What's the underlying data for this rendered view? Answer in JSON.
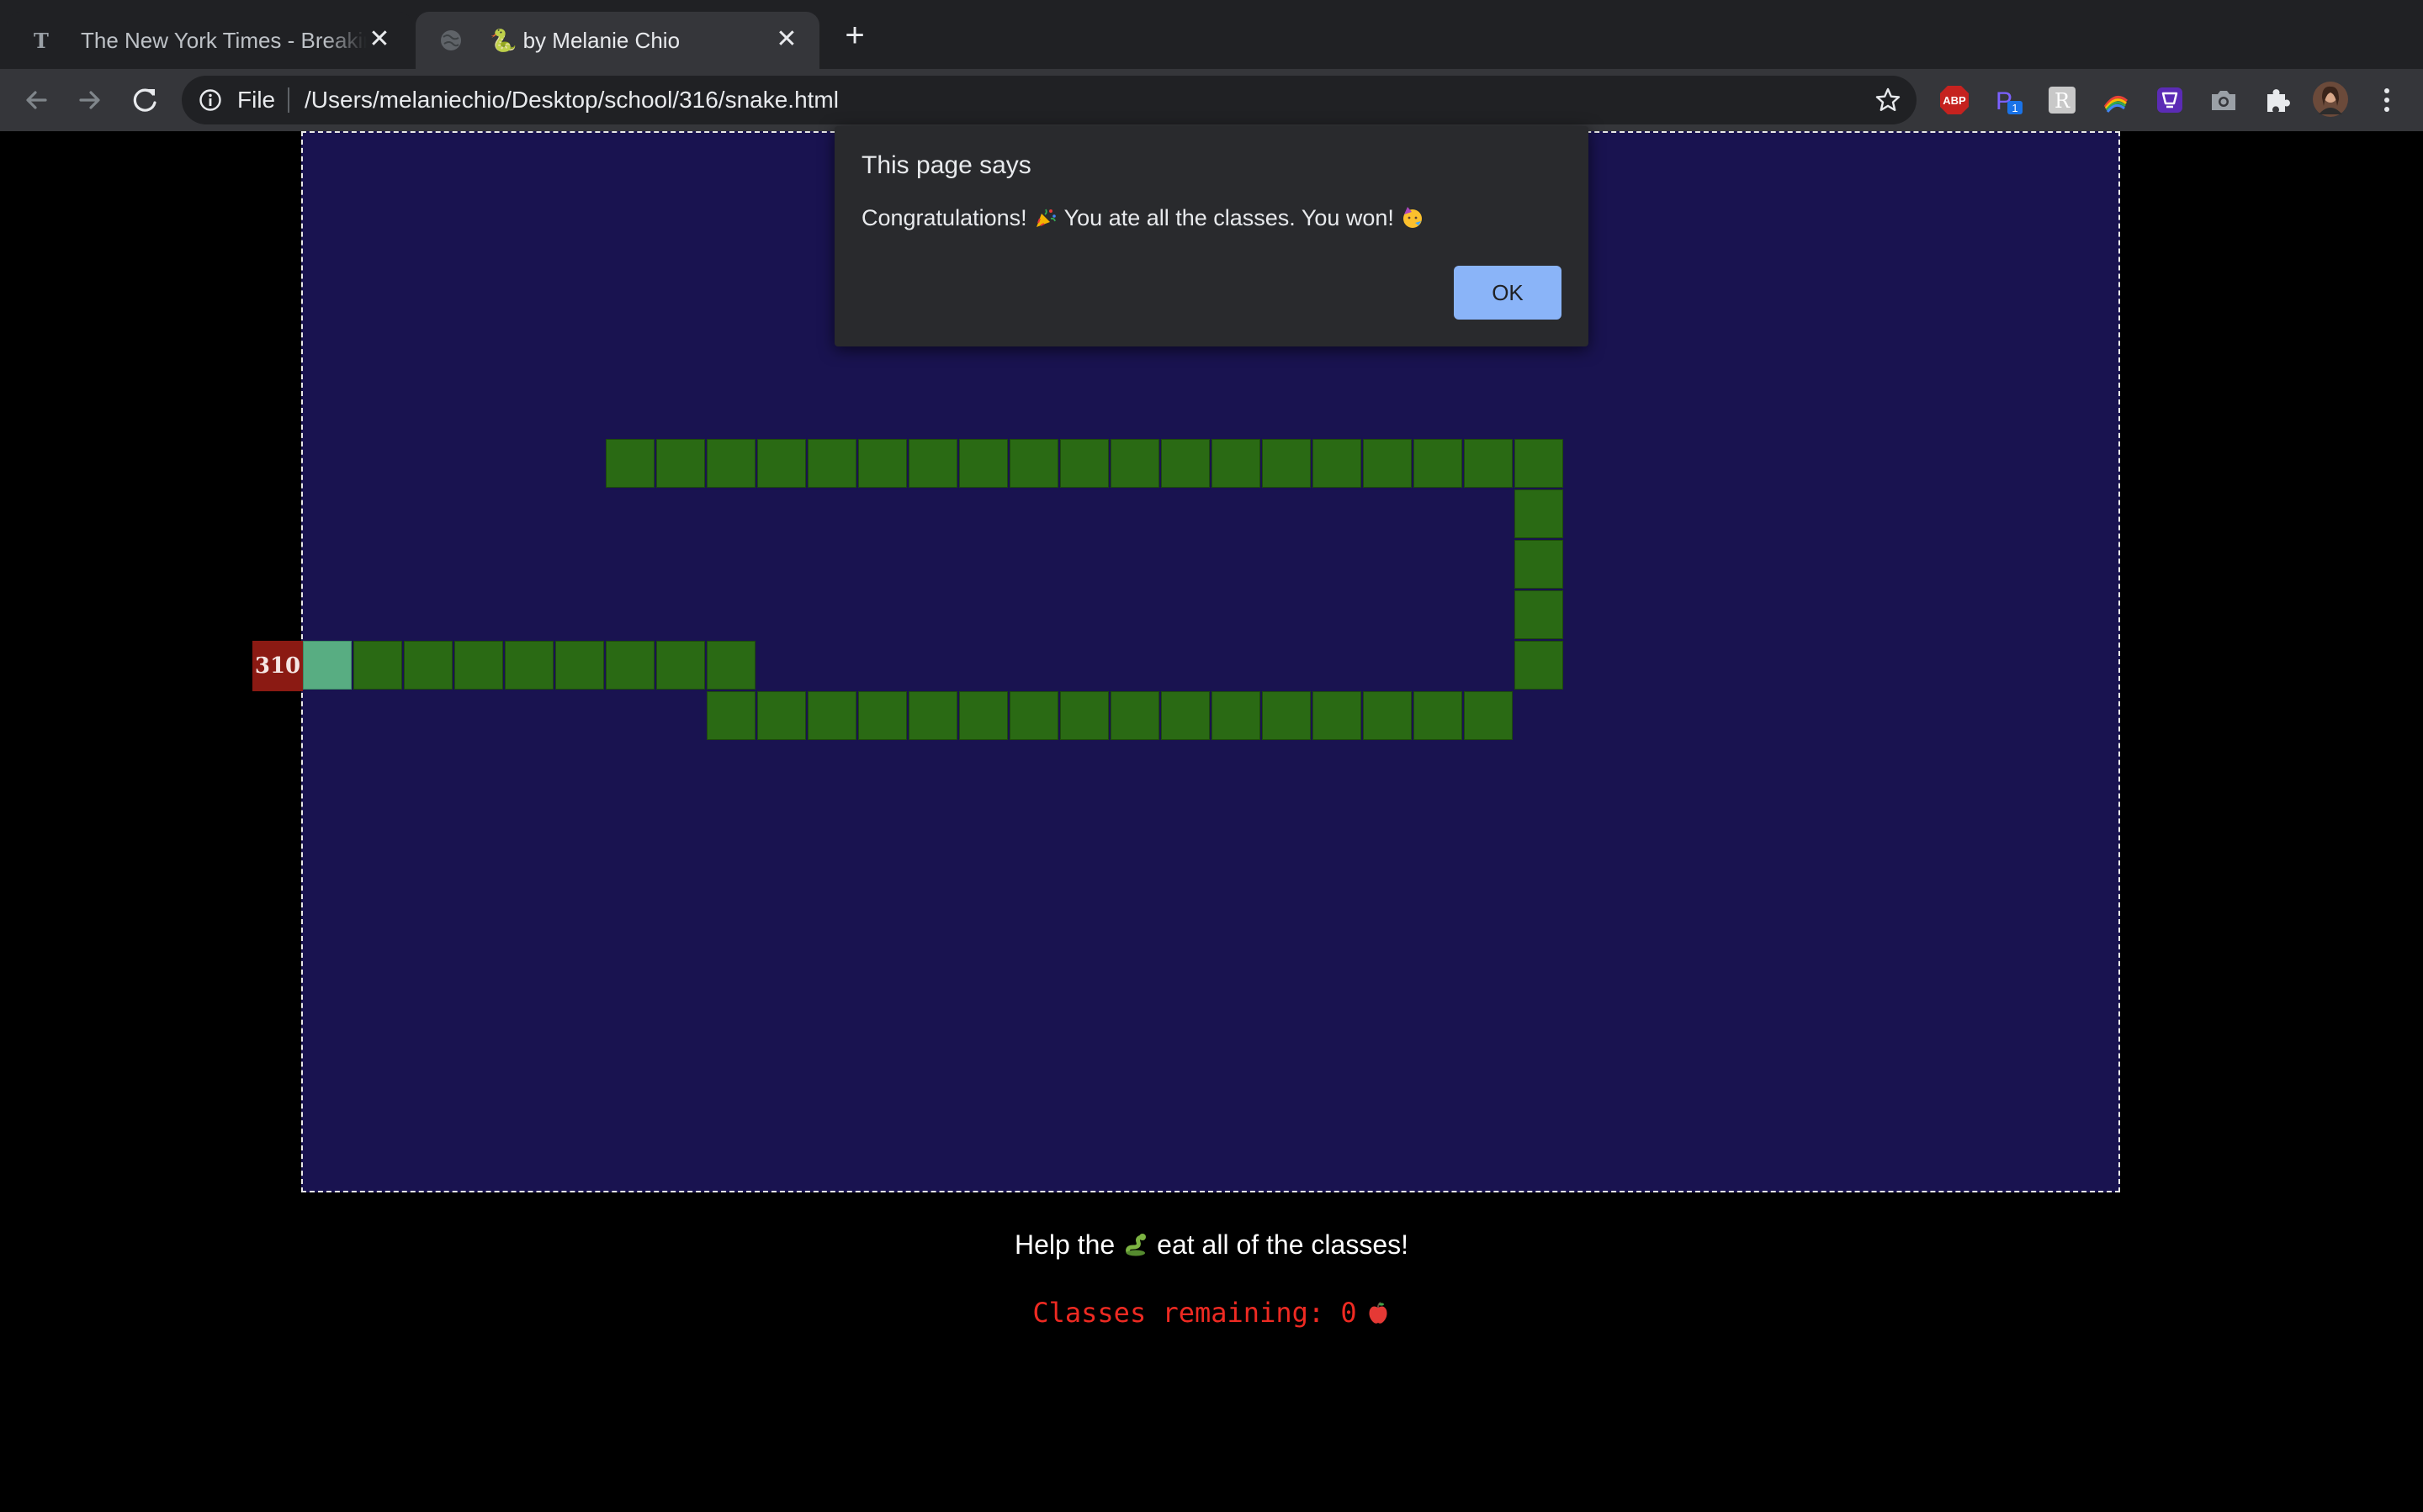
{
  "browser": {
    "tabs": [
      {
        "title": "The New York Times - Breaking News, US News, World News and Videos",
        "favicon": "nyt-icon",
        "active": false
      },
      {
        "title": "🐍 by Melanie Chio",
        "favicon": "globe-icon",
        "active": true
      }
    ],
    "omnibox": {
      "scheme_label": "File",
      "url": "/Users/melaniechio/Desktop/school/316/snake.html"
    },
    "extensions": [
      "adblock-plus-icon",
      "p-extension-icon",
      "r-extension-icon",
      "rainbow-extension-icon",
      "wallet-extension-icon",
      "camera-icon",
      "puzzle-icon",
      "profile-avatar",
      "kebab-menu-icon"
    ],
    "extension_badge": "1",
    "extension_abp_label": "ABP"
  },
  "dialog": {
    "title": "This page says",
    "message_part1": "Congratulations!",
    "message_part2": "You ate all the classes. You won!",
    "ok_label": "OK"
  },
  "game": {
    "food_label": "310",
    "colors": {
      "background": "#191350",
      "snake_body": "#2a6a14",
      "snake_head": "#58ad82",
      "food": "#8b1a13"
    }
  },
  "page": {
    "help_prefix": "Help the",
    "help_suffix": "eat all of the classes!",
    "remaining_text": "Classes remaining: 0"
  }
}
